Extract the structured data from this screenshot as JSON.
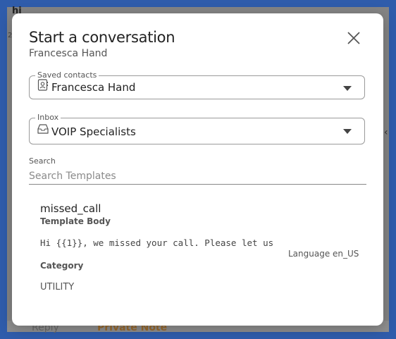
{
  "background": {
    "greeting": "hi",
    "date_fragment": "20",
    "reply_tab": "Reply",
    "private_note_tab": "Private Note"
  },
  "modal": {
    "title": "Start a conversation",
    "subtitle": "Francesca Hand",
    "close_icon": "close-icon"
  },
  "saved_contacts": {
    "label": "Saved contacts",
    "value": "Francesca Hand",
    "icon": "contact-card-icon"
  },
  "inbox": {
    "label": "Inbox",
    "value": "VOIP Specialists",
    "icon": "inbox-tray-icon"
  },
  "search": {
    "label": "Search",
    "placeholder": "Search Templates",
    "value": ""
  },
  "templates": [
    {
      "name": "missed_call",
      "body_label": "Template Body",
      "body": "Hi {{1}}, we missed your call. Please let us",
      "language": "Language en_US",
      "category_label": "Category",
      "category": "UTILITY"
    }
  ],
  "colors": {
    "page_frame": "#2f5cab",
    "backdrop": "#858585",
    "modal_bg": "#ffffff",
    "private_note": "#9a6a2e"
  }
}
